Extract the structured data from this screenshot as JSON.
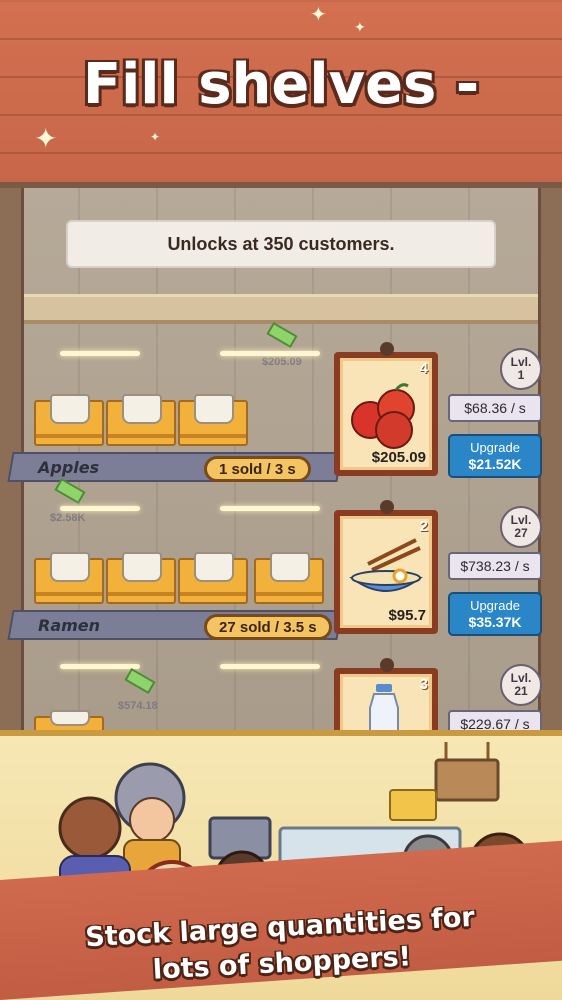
{
  "banner": {
    "title": "Fill shelves -"
  },
  "unlock": {
    "text": "Unlocks at 350 customers."
  },
  "shelves": [
    {
      "name": "Apples",
      "sold_text": "1 sold / 3 s",
      "price": "$205.09",
      "stock_level": "4",
      "level_label": "Lvl.",
      "level_value": "1",
      "rate": "$68.36 / s",
      "upgrade_label": "Upgrade",
      "upgrade_cost": "$21.52K",
      "floating_cash": "$205.09"
    },
    {
      "name": "Ramen",
      "sold_text": "27 sold / 3.5 s",
      "price": "$95.7",
      "stock_level": "2",
      "level_label": "Lvl.",
      "level_value": "27",
      "rate": "$738.23 / s",
      "upgrade_label": "Upgrade",
      "upgrade_cost": "$35.37K",
      "floating_cash": "$2.58K"
    },
    {
      "name": "",
      "price": "",
      "stock_level": "3",
      "level_label": "Lvl.",
      "level_value": "21",
      "rate": "$229.67 / s",
      "floating_cash": "$574.18"
    }
  ],
  "caption": {
    "line1": "Stock large quantities for",
    "line2": "lots of shoppers!"
  },
  "colors": {
    "upgrade": "#2a86c6",
    "frame": "#8a3c22",
    "banner": "#c9674a",
    "pill": "#f4c463"
  }
}
